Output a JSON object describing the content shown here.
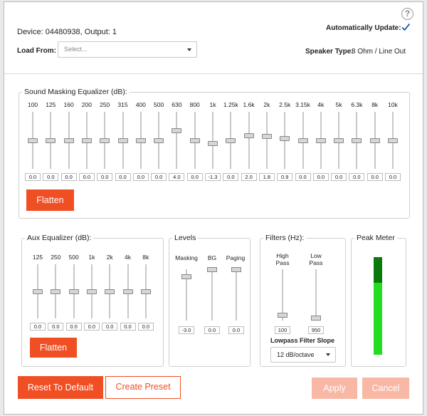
{
  "header": {
    "help_icon": "?",
    "device_info": "Device: 04480938, Output: 1",
    "auto_update_label": "Automatically Update:",
    "auto_update_checked": true,
    "load_from_label": "Load From:",
    "load_from_placeholder": "Select...",
    "speaker_type_label": "Speaker Type:",
    "speaker_type_value": "8 Ohm / Line Out"
  },
  "sound_masking_eq": {
    "legend": "Sound Masking Equalizer (dB):",
    "bands": [
      {
        "freq": "100",
        "value": "0.0",
        "db": 0.0
      },
      {
        "freq": "125",
        "value": "0.0",
        "db": 0.0
      },
      {
        "freq": "160",
        "value": "0.0",
        "db": 0.0
      },
      {
        "freq": "200",
        "value": "0.0",
        "db": 0.0
      },
      {
        "freq": "250",
        "value": "0.0",
        "db": 0.0
      },
      {
        "freq": "315",
        "value": "0.0",
        "db": 0.0
      },
      {
        "freq": "400",
        "value": "0.0",
        "db": 0.0
      },
      {
        "freq": "500",
        "value": "0.0",
        "db": 0.0
      },
      {
        "freq": "630",
        "value": "4.0",
        "db": 4.0
      },
      {
        "freq": "800",
        "value": "0.0",
        "db": 0.0
      },
      {
        "freq": "1k",
        "value": "-1.3",
        "db": -1.3
      },
      {
        "freq": "1.25k",
        "value": "0.0",
        "db": 0.0
      },
      {
        "freq": "1.6k",
        "value": "2.0",
        "db": 2.0
      },
      {
        "freq": "2k",
        "value": "1.8",
        "db": 1.8
      },
      {
        "freq": "2.5k",
        "value": "0.9",
        "db": 0.9
      },
      {
        "freq": "3.15k",
        "value": "0.0",
        "db": 0.0
      },
      {
        "freq": "4k",
        "value": "0.0",
        "db": 0.0
      },
      {
        "freq": "5k",
        "value": "0.0",
        "db": 0.0
      },
      {
        "freq": "6.3k",
        "value": "0.0",
        "db": 0.0
      },
      {
        "freq": "8k",
        "value": "0.0",
        "db": 0.0
      },
      {
        "freq": "10k",
        "value": "0.0",
        "db": 0.0
      }
    ],
    "flatten_label": "Flatten"
  },
  "aux_eq": {
    "legend": "Aux Equalizer (dB):",
    "bands": [
      {
        "freq": "125",
        "value": "0.0",
        "db": 0.0
      },
      {
        "freq": "250",
        "value": "0.0",
        "db": 0.0
      },
      {
        "freq": "500",
        "value": "0.0",
        "db": 0.0
      },
      {
        "freq": "1k",
        "value": "0.0",
        "db": 0.0
      },
      {
        "freq": "2k",
        "value": "0.0",
        "db": 0.0
      },
      {
        "freq": "4k",
        "value": "0.0",
        "db": 0.0
      },
      {
        "freq": "8k",
        "value": "0.0",
        "db": 0.0
      }
    ],
    "flatten_label": "Flatten"
  },
  "levels": {
    "legend": "Levels",
    "masking_label": "Masking",
    "masking_value": "-3.0",
    "masking_fraction": 0.85,
    "bg_label": "BG",
    "bg_value": "0.0",
    "bg_fraction": 1.0,
    "paging_label": "Paging",
    "paging_value": "0.0",
    "paging_fraction": 1.0
  },
  "filters": {
    "legend": "Filters (Hz):",
    "high_pass_label_1": "High",
    "high_pass_label_2": "Pass",
    "high_pass_value": "100",
    "high_pass_fraction": 0.1,
    "low_pass_label_1": "Low",
    "low_pass_label_2": "Pass",
    "low_pass_value": "950",
    "low_pass_fraction": 0.05,
    "slope_label": "Lowpass Filter Slope",
    "slope_value": "12 dB/octave"
  },
  "peak_meter": {
    "legend": "Peak Meter",
    "level_fraction": 0.74,
    "peak_fraction": 0.28,
    "colors": {
      "level": "#22dd22",
      "peak": "#0a7a0a",
      "background": "#e6e6e6"
    }
  },
  "footer": {
    "reset_label": "Reset To Default",
    "preset_label": "Create Preset",
    "apply_label": "Apply",
    "cancel_label": "Cancel"
  },
  "colors": {
    "accent": "#f04e23",
    "accent_disabled": "#f8b8a5",
    "check": "#1a5fb4"
  }
}
